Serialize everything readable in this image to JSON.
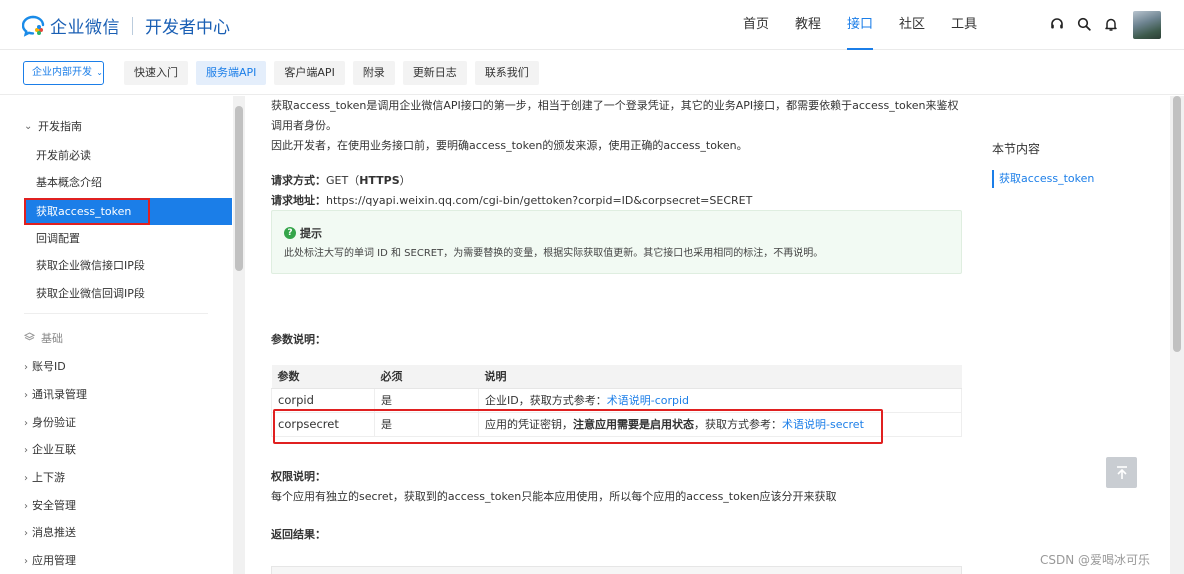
{
  "header": {
    "logo_text": "企业微信",
    "logo_sub": "开发者中心",
    "nav": [
      "首页",
      "教程",
      "接口",
      "社区",
      "工具"
    ],
    "active_nav": "接口",
    "icons": [
      "headset-icon",
      "search-icon",
      "bell-icon"
    ]
  },
  "subnav": {
    "org_select": "企业内部开发",
    "tabs": [
      "快速入门",
      "服务端API",
      "客户端API",
      "附录",
      "更新日志",
      "联系我们"
    ],
    "active_tab": "服务端API"
  },
  "sidebar": {
    "group": "开发指南",
    "items": [
      "开发前必读",
      "基本概念介绍",
      "获取access_token",
      "回调配置",
      "获取企业微信接口IP段",
      "获取企业微信回调IP段"
    ],
    "active_item": "获取access_token",
    "section": "基础",
    "tree": [
      "账号ID",
      "通讯录管理",
      "身份验证",
      "企业互联",
      "上下游",
      "安全管理",
      "消息推送",
      "应用管理"
    ]
  },
  "main": {
    "intro_1": "获取access_token是调用企业微信API接口的第一步，相当于创建了一个登录凭证，其它的业务API接口，都需要依赖于access_token来鉴权调用者身份。",
    "intro_2": "因此开发者，在使用业务接口前，要明确access_token的颁发来源，使用正确的access_token。",
    "method_label": "请求方式：",
    "method_value": "GET（",
    "method_bold": "HTTPS",
    "method_end": "）",
    "url_label": "请求地址：",
    "url_value": "https://qyapi.weixin.qq.com/cgi-bin/gettoken?corpid=ID&corpsecret=SECRET",
    "tip_title": "提示",
    "tip_text": "此处标注大写的单词 ID 和 SECRET，为需要替换的变量，根据实际获取值更新。其它接口也采用相同的标注，不再说明。",
    "params_title": "参数说明：",
    "table": {
      "headers": [
        "参数",
        "必须",
        "说明"
      ],
      "rows": [
        {
          "param": "corpid",
          "required": "是",
          "desc": "企业ID，获取方式参考：",
          "desc_bold": "",
          "desc_after": "",
          "link": "术语说明-corpid"
        },
        {
          "param": "corpsecret",
          "required": "是",
          "desc": "应用的凭证密钥，",
          "desc_bold": "注意应用需要是启用状态",
          "desc_after": "，获取方式参考：",
          "link": "术语说明-secret"
        }
      ]
    },
    "perm_title": "权限说明：",
    "perm_text": "每个应用有独立的secret，获取到的access_token只能本应用使用，所以每个应用的access_token应该分开来获取",
    "return_title": "返回结果："
  },
  "toc": {
    "title": "本节内容",
    "link": "获取access_token"
  },
  "watermark": "CSDN @爱喝冰可乐",
  "colors": {
    "accent": "#1b7ee8",
    "highlight": "#e02020",
    "tip_bg": "#f2faf3"
  }
}
